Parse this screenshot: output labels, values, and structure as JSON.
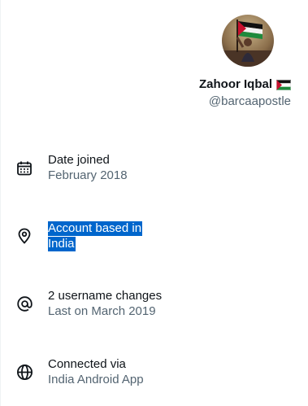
{
  "profile": {
    "display_name": "Zahoor Iqbal",
    "handle": "@barcaapostle",
    "flag": "palestine-flag-icon"
  },
  "about_rows": [
    {
      "icon": "calendar-icon",
      "primary": "Date joined",
      "secondary": "February 2018"
    },
    {
      "icon": "location-pin-icon",
      "primary_line1": "Account based in",
      "primary_line2": "India",
      "selected": true
    },
    {
      "icon": "at-sign-icon",
      "primary": "2 username changes",
      "secondary": "Last on March 2019"
    },
    {
      "icon": "globe-icon",
      "primary": "Connected via",
      "secondary": "India Android App"
    }
  ],
  "colors": {
    "text_primary": "#0f1419",
    "text_secondary": "#536471",
    "selection": "#0066cc"
  }
}
